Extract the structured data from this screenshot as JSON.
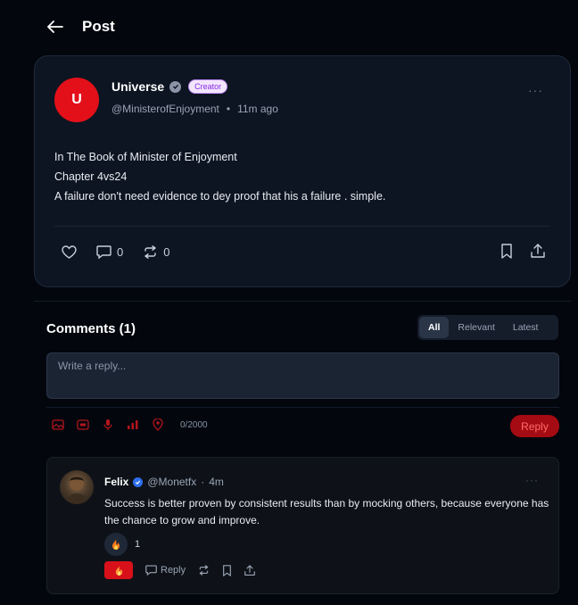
{
  "header": {
    "title": "Post"
  },
  "post": {
    "avatar_initial": "U",
    "author_name": "Universe",
    "badge": "Creator",
    "handle": "@MinisterofEnjoyment",
    "separator": "•",
    "time": "11m ago",
    "body_lines": [
      "In The Book of Minister of Enjoyment",
      "Chapter 4vs24",
      "A failure don't need evidence to dey proof that his a failure . simple."
    ],
    "comment_count": "0",
    "repost_count": "0",
    "more": "···"
  },
  "comments": {
    "title": "Comments (1)",
    "sort_tabs": [
      "All",
      "Relevant",
      "Latest"
    ],
    "reply_placeholder": "Write a reply...",
    "char_count": "0/2000",
    "reply_button": "Reply"
  },
  "comment": {
    "author": "Felix",
    "handle": "@Monetfx",
    "separator": "·",
    "time": "4m",
    "text": "Success is better proven by consistent results than by mocking others, because everyone has the chance to grow and improve.",
    "reaction_count": "1",
    "reply_label": "Reply",
    "more": "···"
  },
  "colors": {
    "background": "#03060d",
    "card": "#0d1522",
    "accent_red": "#e3101a",
    "creator_badge": "#8a2be2",
    "verified_blue": "#2f6fed"
  }
}
